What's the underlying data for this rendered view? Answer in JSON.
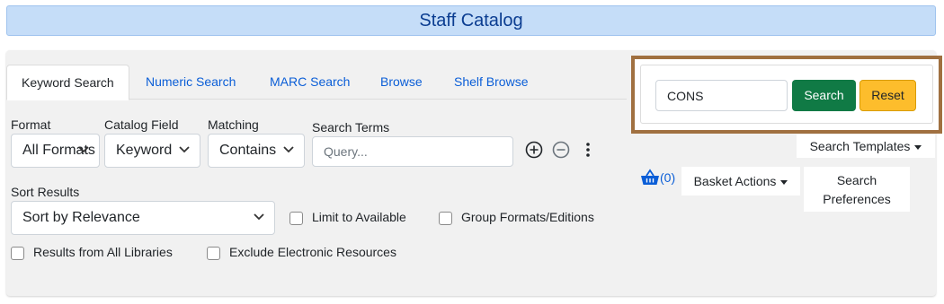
{
  "header": {
    "title": "Staff Catalog"
  },
  "tabs": [
    {
      "label": "Keyword Search",
      "active": true
    },
    {
      "label": "Numeric Search",
      "active": false
    },
    {
      "label": "MARC Search",
      "active": false
    },
    {
      "label": "Browse",
      "active": false
    },
    {
      "label": "Shelf Browse",
      "active": false
    }
  ],
  "search_row": {
    "format_label": "Format",
    "format_value": "All Formats",
    "field_label": "Catalog Field",
    "field_value": "Keyword",
    "matching_label": "Matching",
    "matching_value": "Contains",
    "terms_label": "Search Terms",
    "terms_placeholder": "Query...",
    "terms_value": ""
  },
  "sort": {
    "label": "Sort Results",
    "value": "Sort by Relevance"
  },
  "options": {
    "limit_available": {
      "label": "Limit to Available",
      "checked": false
    },
    "group_formats": {
      "label": "Group Formats/Editions",
      "checked": false
    },
    "all_libraries": {
      "label": "Results from All Libraries",
      "checked": false
    },
    "exclude_electronic": {
      "label": "Exclude Electronic Resources",
      "checked": false
    }
  },
  "quick_search": {
    "value": "CONS",
    "search_label": "Search",
    "reset_label": "Reset",
    "search_color": "#107a45",
    "reset_color": "#fdbd2c"
  },
  "side": {
    "templates_label": "Search Templates",
    "basket_count": "(0)",
    "basket_actions_label": "Basket Actions",
    "preferences_line1": "Search",
    "preferences_line2": "Preferences"
  },
  "icons": {
    "add_row": "plus-circle-icon",
    "remove_row": "minus-circle-icon",
    "more": "more-vertical-icon",
    "basket": "basket-icon"
  },
  "colors": {
    "accent": "#0b5ed7",
    "header_bg": "#c5ddf8",
    "highlight_border": "#a07040"
  }
}
